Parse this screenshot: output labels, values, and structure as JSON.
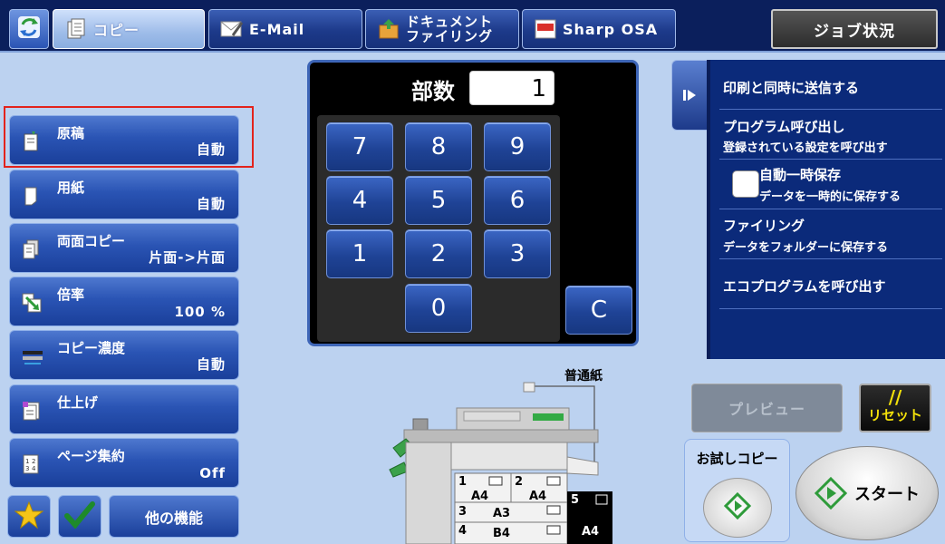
{
  "topbar": {
    "tabs": [
      {
        "label": "コピー",
        "icon": "copy-icon",
        "active": true
      },
      {
        "label": "E-Mail",
        "icon": "email-icon",
        "active": false
      },
      {
        "label_line1": "ドキュメント",
        "label_line2": "ファイリング",
        "icon": "document-filing-icon",
        "active": false
      },
      {
        "label": "Sharp OSA",
        "icon": "sharp-osa-icon",
        "active": false
      }
    ],
    "job_status_label": "ジョブ状況"
  },
  "left_menu": [
    {
      "title": "原稿",
      "value": "自動",
      "icon": "original-icon"
    },
    {
      "title": "用紙",
      "value": "自動",
      "icon": "paper-icon"
    },
    {
      "title": "両面コピー",
      "value": "片面->片面",
      "icon": "duplex-icon"
    },
    {
      "title": "倍率",
      "value": "100 %",
      "icon": "zoom-icon"
    },
    {
      "title": "コピー濃度",
      "value": "自動",
      "icon": "density-icon"
    },
    {
      "title": "仕上げ",
      "value": "",
      "icon": "finishing-icon"
    },
    {
      "title": "ページ集約",
      "value": "Off",
      "icon": "n-up-icon"
    }
  ],
  "bottom_left": {
    "favorite_icon": "star-icon",
    "check_icon": "checkmark-icon",
    "other_functions_label": "他の機能"
  },
  "keypad": {
    "copies_label": "部数",
    "copies_value": "1",
    "keys": [
      "7",
      "8",
      "9",
      "4",
      "5",
      "6",
      "1",
      "2",
      "3",
      "0"
    ],
    "clear_key": "C"
  },
  "right_panel": {
    "expand_icon": "expand-arrow-icon",
    "items": [
      {
        "line1": "印刷と同時に送信する",
        "line2": ""
      },
      {
        "line1": "プログラム呼び出し",
        "line2": "登録されている設定を呼び出す"
      },
      {
        "line1": "自動一時保存",
        "line2": "データを一時的に保存する"
      },
      {
        "line1": "ファイリング",
        "line2": "データをフォルダーに保存する"
      },
      {
        "line1": "エコプログラムを呼び出す",
        "line2": ""
      }
    ]
  },
  "preview_label": "プレビュー",
  "reset": {
    "symbol": "//",
    "label": "リセット"
  },
  "trial_copy_label": "お試しコピー",
  "start_label": "スタート",
  "machine": {
    "paper_label": "普通紙",
    "trays": [
      {
        "num": "1",
        "size": "A4"
      },
      {
        "num": "2",
        "size": "A4"
      },
      {
        "num": "3",
        "size": "A3"
      },
      {
        "num": "4",
        "size": "B4"
      },
      {
        "num": "5",
        "size": "A4"
      }
    ]
  }
}
